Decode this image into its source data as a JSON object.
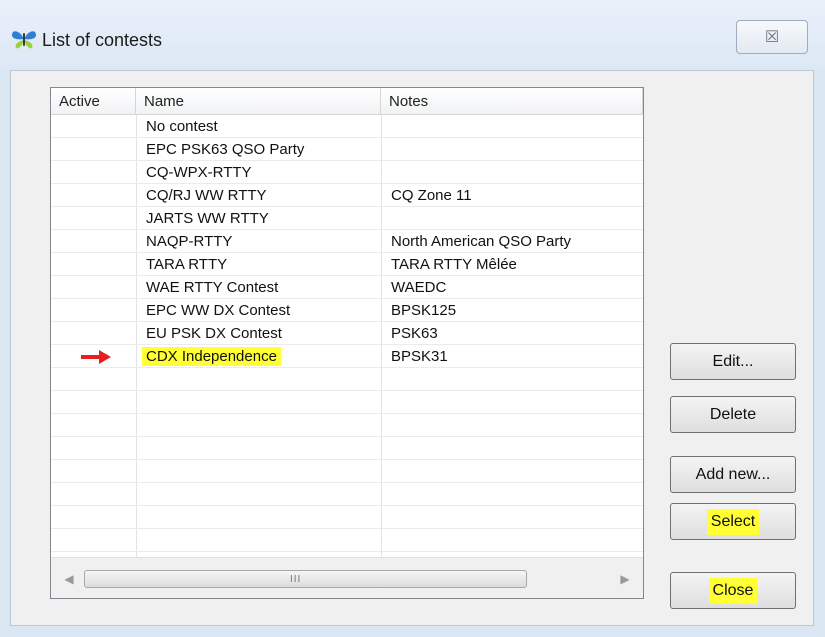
{
  "window": {
    "title": "List of contests",
    "close_glyph": "☒"
  },
  "columns": [
    "Active",
    "Name",
    "Notes"
  ],
  "rows": [
    {
      "active": "",
      "name": "No contest",
      "notes": ""
    },
    {
      "active": "",
      "name": "EPC PSK63 QSO Party",
      "notes": ""
    },
    {
      "active": "",
      "name": "CQ-WPX-RTTY",
      "notes": ""
    },
    {
      "active": "",
      "name": "CQ/RJ WW RTTY",
      "notes": "CQ Zone 11"
    },
    {
      "active": "",
      "name": "JARTS WW RTTY",
      "notes": ""
    },
    {
      "active": "",
      "name": "NAQP-RTTY",
      "notes": "North American QSO Party"
    },
    {
      "active": "",
      "name": "TARA RTTY",
      "notes": "TARA RTTY Mêlée"
    },
    {
      "active": "",
      "name": "WAE RTTY Contest",
      "notes": "WAEDC"
    },
    {
      "active": "",
      "name": "EPC WW DX Contest",
      "notes": "BPSK125"
    },
    {
      "active": "",
      "name": "EU PSK DX Contest",
      "notes": "PSK63"
    },
    {
      "active": "",
      "name": "CDX Independence",
      "notes": "BPSK31"
    }
  ],
  "buttons": {
    "edit": "Edit...",
    "delete": "Delete",
    "add_new": "Add new...",
    "select": "Select",
    "close": "Close"
  },
  "scrollbar": {
    "left_arrow": "◀",
    "right_arrow": "▶",
    "grip": "III"
  },
  "colors": {
    "highlight": "#ffff33",
    "arrow": "#e81e1e",
    "icon_blue": "#2f7fd6",
    "icon_green": "#9bd23c"
  },
  "icons": {
    "app": "butterfly-icon",
    "marker": "red-arrow-icon"
  }
}
